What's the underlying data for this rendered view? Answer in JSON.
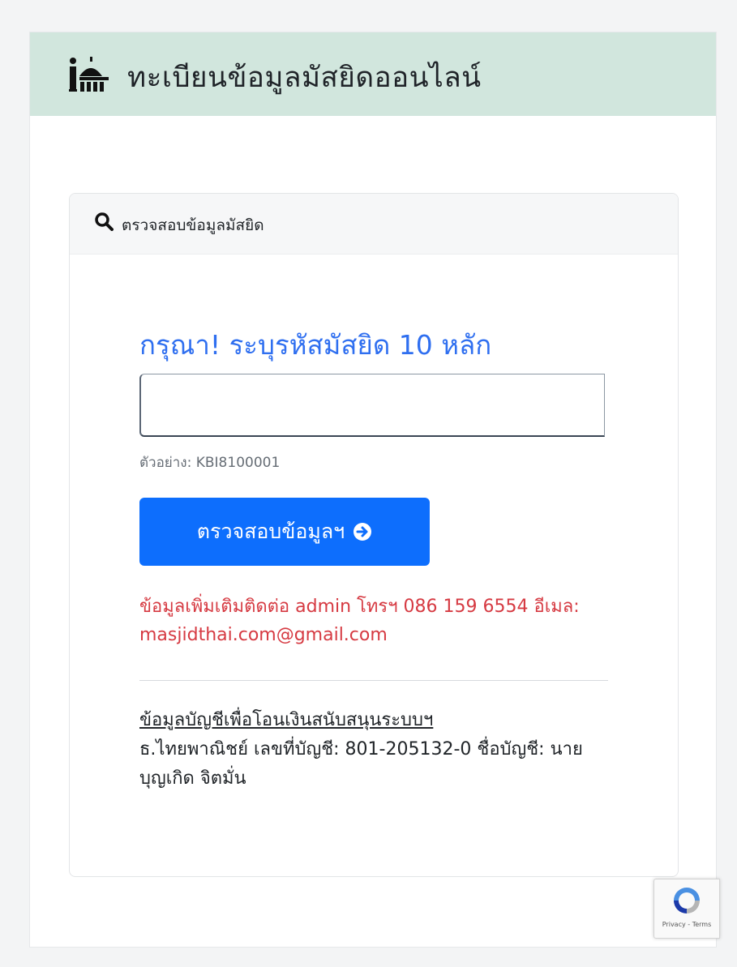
{
  "header": {
    "title": "ทะเบียนข้อมูลมัสยิดออนไลน์",
    "icon": "info-mosque-icon",
    "background": "#d1e6dd"
  },
  "card": {
    "header_title": "ตรวจสอบข้อมูลมัสยิด",
    "header_icon": "search-icon",
    "prompt": "กรุณา! ระบุรหัสมัสยิด 10 หลัก",
    "input_value": "",
    "hint": "ตัวอย่าง: KBI8100001",
    "button_label": "ตรวจสอบข้อมูลฯ",
    "button_icon": "arrow-right-circle-icon",
    "contact_text": "ข้อมูลเพิ่มเติมติดต่อ admin โทรฯ 086 159 6554 อีเมล: masjidthai.com@gmail.com",
    "bank_title": "ข้อมูลบัญชีเพื่อโอนเงินสนับสนุนระบบฯ",
    "bank_detail": "ธ.ไทยพาณิชย์ เลขที่บัญชี: 801-205132-0 ชื่อบัญชี: นายบุญเกิด จิตมั่น"
  },
  "recaptcha": {
    "links": "Privacy - Terms",
    "icon": "recaptcha-icon"
  },
  "colors": {
    "accent": "#0d6efd",
    "prompt": "#2f6ff0",
    "contact": "#d63a42"
  }
}
